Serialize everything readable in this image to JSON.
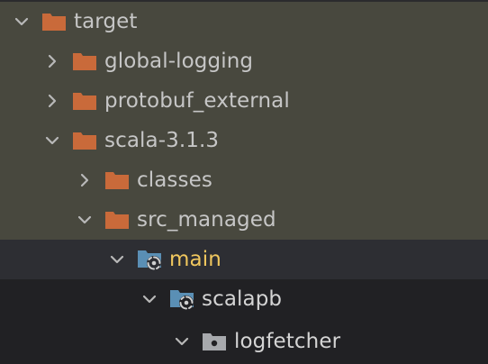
{
  "colors": {
    "excluded_row_bg": "#48483e",
    "selected_row_bg": "#2d2e33",
    "normal_row_bg": "#212124",
    "orange_folder": "#c96a3a",
    "source_folder": "#5a8fb5",
    "package_folder": "#a7a9ad",
    "selected_text": "#f0c75e"
  },
  "tree": {
    "items": [
      {
        "label": "target",
        "state": "expanded",
        "icon": "excluded-folder-icon"
      },
      {
        "label": "global-logging",
        "state": "collapsed",
        "icon": "excluded-folder-icon"
      },
      {
        "label": "protobuf_external",
        "state": "collapsed",
        "icon": "excluded-folder-icon"
      },
      {
        "label": "scala-3.1.3",
        "state": "expanded",
        "icon": "excluded-folder-icon"
      },
      {
        "label": "classes",
        "state": "collapsed",
        "icon": "excluded-folder-icon"
      },
      {
        "label": "src_managed",
        "state": "expanded",
        "icon": "excluded-folder-icon"
      },
      {
        "label": "main",
        "state": "expanded",
        "icon": "generated-source-folder-icon"
      },
      {
        "label": "scalapb",
        "state": "expanded",
        "icon": "generated-source-folder-icon"
      },
      {
        "label": "logfetcher",
        "state": "expanded",
        "icon": "package-folder-icon"
      }
    ]
  }
}
